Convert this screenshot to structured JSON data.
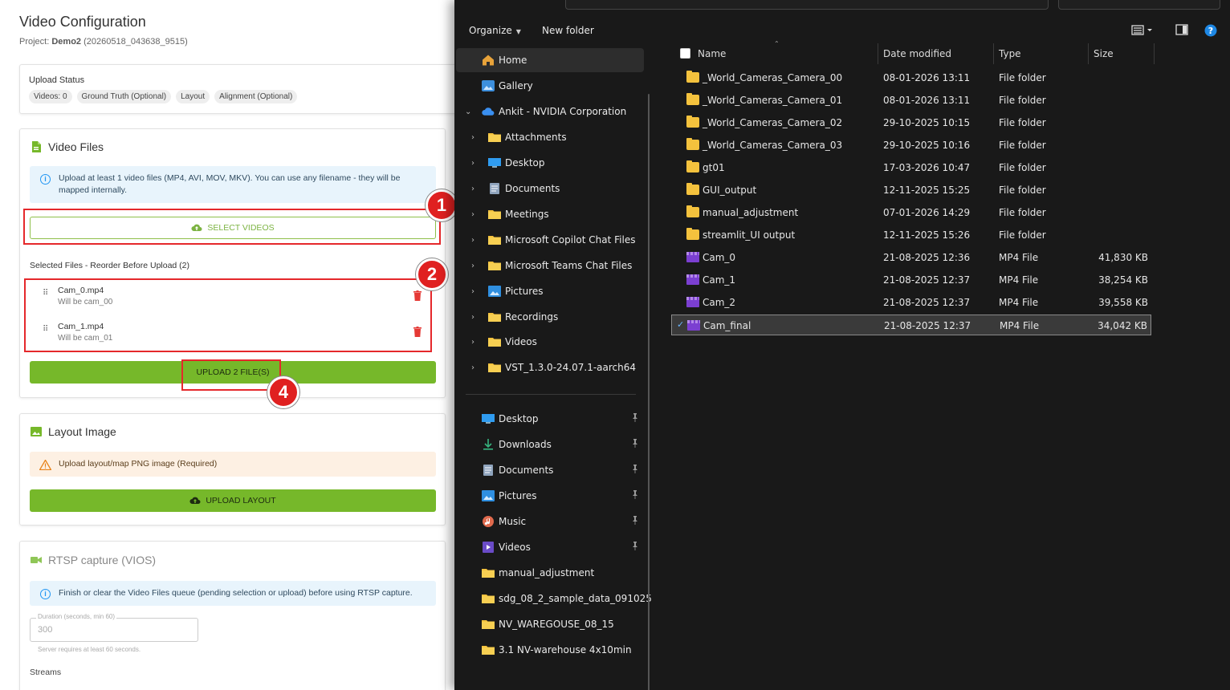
{
  "web": {
    "title": "Video Configuration",
    "project_label": "Project:",
    "project_name": "Demo2",
    "project_id": "(20260518_043638_9515)",
    "upload_status": {
      "label": "Upload Status",
      "chips": [
        "Videos: 0",
        "Ground Truth (Optional)",
        "Layout",
        "Alignment (Optional)"
      ]
    },
    "video_files": {
      "title": "Video Files",
      "info": "Upload at least 1 video files (MP4, AVI, MOV, MKV). You can use any filename - they will be mapped internally.",
      "select_button": "SELECT VIDEOS",
      "selected_label": "Selected Files - Reorder Before Upload (2)",
      "files": [
        {
          "name": "Cam_0.mp4",
          "sub": "Will be cam_00"
        },
        {
          "name": "Cam_1.mp4",
          "sub": "Will be cam_01"
        }
      ],
      "upload_button": "UPLOAD 2 FILE(S)"
    },
    "layout_image": {
      "title": "Layout Image",
      "warning": "Upload layout/map PNG image (Required)",
      "upload_button": "UPLOAD LAYOUT"
    },
    "rtsp": {
      "title": "RTSP capture (VIOS)",
      "info": "Finish or clear the Video Files queue (pending selection or upload) before using RTSP capture.",
      "duration_label": "Duration (seconds, min 60)",
      "duration_value": "300",
      "duration_help": "Server requires at least 60 seconds.",
      "streams_label": "Streams"
    },
    "badges": [
      "1",
      "2",
      "4"
    ],
    "colors": {
      "accent_green": "#76b82a",
      "annotation_red": "#e5282b"
    }
  },
  "explorer": {
    "toolbar": {
      "organize": "Organize",
      "new_folder": "New folder"
    },
    "nav": {
      "top": [
        {
          "label": "Home",
          "icon": "home-icon",
          "selected": true
        },
        {
          "label": "Gallery",
          "icon": "gallery-icon"
        }
      ],
      "onedrive": {
        "label": "Ankit - NVIDIA Corporation",
        "icon": "cloud-icon"
      },
      "onedrive_children": [
        {
          "label": "Attachments",
          "icon": "folder-icon"
        },
        {
          "label": "Desktop",
          "icon": "desktop-icon"
        },
        {
          "label": "Documents",
          "icon": "documents-icon"
        },
        {
          "label": "Meetings",
          "icon": "folder-icon"
        },
        {
          "label": "Microsoft Copilot Chat Files",
          "icon": "folder-icon"
        },
        {
          "label": "Microsoft Teams Chat Files",
          "icon": "folder-icon"
        },
        {
          "label": "Pictures",
          "icon": "pictures-icon"
        },
        {
          "label": "Recordings",
          "icon": "folder-icon"
        },
        {
          "label": "Videos",
          "icon": "folder-icon"
        },
        {
          "label": "VST_1.3.0-24.07.1-aarch64",
          "icon": "folder-icon"
        }
      ],
      "quick_access": [
        {
          "label": "Desktop",
          "icon": "desktop-icon",
          "pinned": true
        },
        {
          "label": "Downloads",
          "icon": "download-icon",
          "pinned": true
        },
        {
          "label": "Documents",
          "icon": "documents-icon",
          "pinned": true
        },
        {
          "label": "Pictures",
          "icon": "pictures-icon",
          "pinned": true
        },
        {
          "label": "Music",
          "icon": "music-icon",
          "pinned": true
        },
        {
          "label": "Videos",
          "icon": "videos-icon",
          "pinned": true
        },
        {
          "label": "manual_adjustment",
          "icon": "folder-icon"
        },
        {
          "label": "sdg_08_2_sample_data_091025",
          "icon": "folder-icon"
        },
        {
          "label": "NV_WAREGOUSE_08_15",
          "icon": "folder-icon"
        },
        {
          "label": "3.1 NV-warehouse 4x10min",
          "icon": "folder-icon"
        }
      ]
    },
    "columns": {
      "name": "Name",
      "date": "Date modified",
      "type": "Type",
      "size": "Size"
    },
    "files": [
      {
        "name": "_World_Cameras_Camera_00",
        "date": "08-01-2026 13:11",
        "type": "File folder",
        "size": "",
        "kind": "folder"
      },
      {
        "name": "_World_Cameras_Camera_01",
        "date": "08-01-2026 13:11",
        "type": "File folder",
        "size": "",
        "kind": "folder"
      },
      {
        "name": "_World_Cameras_Camera_02",
        "date": "29-10-2025 10:15",
        "type": "File folder",
        "size": "",
        "kind": "folder"
      },
      {
        "name": "_World_Cameras_Camera_03",
        "date": "29-10-2025 10:16",
        "type": "File folder",
        "size": "",
        "kind": "folder"
      },
      {
        "name": "gt01",
        "date": "17-03-2026 10:47",
        "type": "File folder",
        "size": "",
        "kind": "folder"
      },
      {
        "name": "GUI_output",
        "date": "12-11-2025 15:25",
        "type": "File folder",
        "size": "",
        "kind": "folder"
      },
      {
        "name": "manual_adjustment",
        "date": "07-01-2026 14:29",
        "type": "File folder",
        "size": "",
        "kind": "folder"
      },
      {
        "name": "streamlit_UI output",
        "date": "12-11-2025 15:26",
        "type": "File folder",
        "size": "",
        "kind": "folder"
      },
      {
        "name": "Cam_0",
        "date": "21-08-2025 12:36",
        "type": "MP4 File",
        "size": "41,830 KB",
        "kind": "mp4"
      },
      {
        "name": "Cam_1",
        "date": "21-08-2025 12:37",
        "type": "MP4 File",
        "size": "38,254 KB",
        "kind": "mp4"
      },
      {
        "name": "Cam_2",
        "date": "21-08-2025 12:37",
        "type": "MP4 File",
        "size": "39,558 KB",
        "kind": "mp4"
      },
      {
        "name": "Cam_final",
        "date": "21-08-2025 12:37",
        "type": "MP4 File",
        "size": "34,042 KB",
        "kind": "mp4",
        "selected": true
      }
    ]
  }
}
